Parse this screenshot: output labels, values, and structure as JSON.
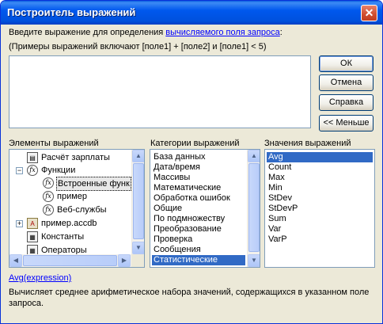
{
  "window": {
    "title": "Построитель выражений",
    "close_label": "✕"
  },
  "prompt": {
    "text_before": "Введите выражение для определения ",
    "link": "вычисляемого поля запроса",
    "text_after": ":",
    "examples": "(Примеры выражений включают [поле1] + [поле2] и [поле1] < 5)"
  },
  "expression_value": "",
  "buttons": {
    "ok": "ОК",
    "cancel": "Отмена",
    "help": "Справка",
    "less": "<< Меньше"
  },
  "elements_panel": {
    "label": "Элементы выражений",
    "items": [
      {
        "label": "Расчёт зарплаты",
        "icon": "form-icon"
      },
      {
        "label": "Функции",
        "icon": "function-icon",
        "expander": "−"
      },
      {
        "label": "Встроенные функ",
        "icon": "function-icon"
      },
      {
        "label": "пример",
        "icon": "function-icon"
      },
      {
        "label": "Веб-службы",
        "icon": "function-icon"
      },
      {
        "label": "пример.accdb",
        "icon": "database-icon",
        "expander": "+"
      },
      {
        "label": "Константы",
        "icon": "constants-icon"
      },
      {
        "label": "Операторы",
        "icon": "operators-icon"
      }
    ]
  },
  "categories_panel": {
    "label": "Категории выражений",
    "items": [
      "База данных",
      "Дата/время",
      "Массивы",
      "Математические",
      "Обработка ошибок",
      "Общие",
      "По подмножеству",
      "Преобразование",
      "Проверка",
      "Сообщения",
      "Статистические"
    ],
    "selected": "Статистические"
  },
  "values_panel": {
    "label": "Значения выражений",
    "items": [
      "Avg",
      "Count",
      "Max",
      "Min",
      "StDev",
      "StDevP",
      "Sum",
      "Var",
      "VarP"
    ],
    "selected": "Avg"
  },
  "footer": {
    "syntax_link": "Avg(expression)",
    "description": "Вычисляет среднее арифметическое набора значений, содержащихся в указанном поле запроса."
  },
  "colors": {
    "title_bar": "#0054e3",
    "selection": "#316ac5",
    "dialog_bg": "#ece9d8"
  }
}
